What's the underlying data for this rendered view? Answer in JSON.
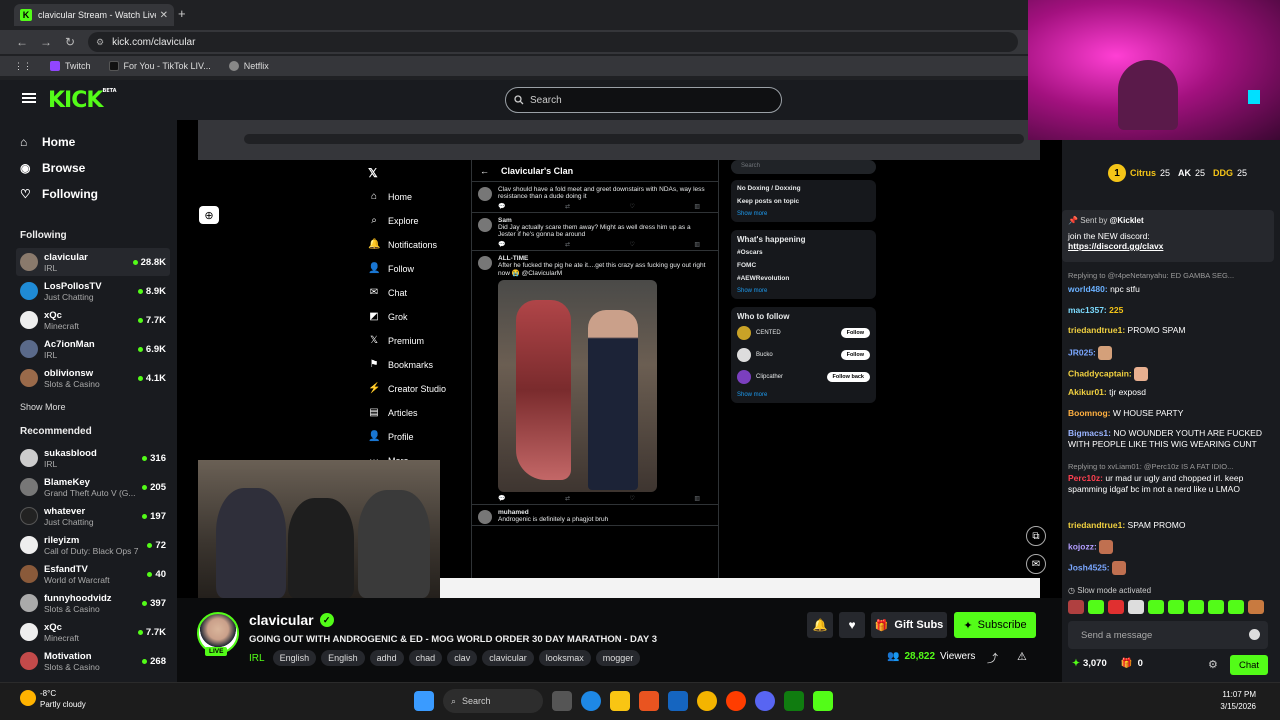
{
  "browser": {
    "tab_title": "clavicular Stream - Watch Live o",
    "url": "kick.com/clavicular",
    "bookmarks": [
      "Twitch",
      "For You - TikTok LIV...",
      "Netflix"
    ]
  },
  "header": {
    "logo": "KICK",
    "beta": "BETA",
    "search_placeholder": "Search"
  },
  "sidebar": {
    "nav": [
      {
        "label": "Home",
        "icon": "home-icon"
      },
      {
        "label": "Browse",
        "icon": "browse-icon"
      },
      {
        "label": "Following",
        "icon": "heart-icon"
      }
    ],
    "following_title": "Following",
    "following": [
      {
        "name": "clavicular",
        "category": "IRL",
        "viewers": "28.8K"
      },
      {
        "name": "LosPollosTV",
        "category": "Just Chatting",
        "viewers": "8.9K"
      },
      {
        "name": "xQc",
        "category": "Minecraft",
        "viewers": "7.7K"
      },
      {
        "name": "Ac7ionMan",
        "category": "IRL",
        "viewers": "6.9K"
      },
      {
        "name": "oblivionsw",
        "category": "Slots & Casino",
        "viewers": "4.1K"
      }
    ],
    "show_more": "Show More",
    "recommended_title": "Recommended",
    "recommended": [
      {
        "name": "sukasblood",
        "category": "IRL",
        "viewers": "316"
      },
      {
        "name": "BlameKey",
        "category": "Grand Theft Auto V (G...",
        "viewers": "205"
      },
      {
        "name": "whatever",
        "category": "Just Chatting",
        "viewers": "197"
      },
      {
        "name": "rileyizm",
        "category": "Call of Duty: Black Ops 7",
        "viewers": "72"
      },
      {
        "name": "EsfandTV",
        "category": "World of Warcraft",
        "viewers": "40"
      },
      {
        "name": "funnyhoodvidz",
        "category": "Slots & Casino",
        "viewers": "397"
      },
      {
        "name": "xQc",
        "category": "Minecraft",
        "viewers": "7.7K"
      },
      {
        "name": "Motivation",
        "category": "Slots & Casino",
        "viewers": "268"
      }
    ]
  },
  "stream_screen": {
    "x_nav": [
      "Home",
      "Explore",
      "Notifications",
      "Follow",
      "Chat",
      "Grok",
      "Premium",
      "Bookmarks",
      "Creator Studio",
      "Articles",
      "Profile",
      "More"
    ],
    "feed_title": "Clavicular's Clan",
    "posts": [
      {
        "text": "Clav should have a fold meet and greet downstairs with NDAs, way less resistance than a dude doing it"
      },
      {
        "author": "Sam",
        "text": "Did Jay actually scare them away? Might as well dress him up as a Jester if he's gonna be around"
      },
      {
        "author": "ALL-TIME",
        "text": "After he fucked the pig he ate it....get this crazy ass fucking guy out right now 😭 @ClavicularM"
      },
      {
        "author": "muhamed",
        "text": "Androgenic is definitely a phagjot bruh"
      }
    ],
    "right_items": [
      "No Doxing / Doxxing",
      "Keep posts on topic"
    ],
    "whats_happening": "What's happening",
    "trends": [
      "#Oscars",
      "FOMC",
      "#AEWRevolution"
    ],
    "show_more": "Show more",
    "who_to_follow": "Who to follow",
    "follow_suggestions": [
      {
        "name": "CENTED",
        "button": "Follow"
      },
      {
        "name": "Bucko",
        "button": "Follow"
      },
      {
        "name": "Clipcather",
        "button": "Follow back"
      }
    ]
  },
  "stream_info": {
    "channel": "clavicular",
    "live": "LIVE",
    "title": "GOING OUT WITH ANDROGENIC & ED - MOG WORLD ORDER 30 DAY MARATHON - DAY 3",
    "category": "IRL",
    "tags": [
      "English",
      "English",
      "adhd",
      "chad",
      "clav",
      "clavicular",
      "looksmax",
      "mogger"
    ],
    "gift_subs": "Gift Subs",
    "subscribe": "Subscribe",
    "viewers": "28,822",
    "viewers_label": "Viewers"
  },
  "chat": {
    "gifters": [
      {
        "name": "Citrus",
        "amount": "25"
      },
      {
        "name": "AK",
        "amount": "25"
      },
      {
        "name": "DDG",
        "amount": "25"
      }
    ],
    "gifter_rank": "1",
    "pinned_by": "Sent by",
    "pinned_user": "@Kicklet",
    "pinned_text": "join the NEW discord:",
    "pinned_link": "https://discord.gg/clavx",
    "messages": [
      {
        "reply": "Replying to @r4peNetanyahu: ED GAMBA SEG..."
      },
      {
        "user": "world480:",
        "text": "npc stfu",
        "color": "#6ab0ff"
      },
      {
        "user": "mac1357:",
        "text": "225",
        "color": "#7ddcff"
      },
      {
        "user": "triedandtrue1:",
        "text": "PROMO SPAM",
        "color": "#f0d040"
      },
      {
        "user": "JR025:",
        "text": "",
        "color": "#7aa7ff"
      },
      {
        "user": "Chaddycaptain:",
        "text": "",
        "color": "#f0d040"
      },
      {
        "user": "Akikur01:",
        "text": "tjr exposd",
        "color": "#f0d040"
      },
      {
        "user": "Boomnog:",
        "text": "W HOUSE PARTY",
        "color": "#ffb040"
      },
      {
        "user": "Bigmacs1:",
        "text": "NO WOUNDER YOUTH ARE FUCKED WITH PEOPLE LIKE THIS WIG WEARING CUNT",
        "color": "#9ab4ff"
      },
      {
        "reply": "Replying to xvLiam01: @Perc10z IS A FAT IDIO..."
      },
      {
        "user": "Perc10z:",
        "text": "ur mad ur ugly and chopped irl. keep spamming idgaf bc im not a nerd like u LMAO",
        "color": "#ff4050"
      },
      {
        "user": "triedandtrue1:",
        "text": "SPAM PROMO",
        "color": "#f0d040"
      },
      {
        "user": "kojozz:",
        "text": "",
        "color": "#b39dff"
      },
      {
        "user": "Josh4525:",
        "text": "",
        "color": "#7aa7ff"
      }
    ],
    "slow_mode": "Slow mode activated",
    "input_placeholder": "Send a message",
    "points": "3,070",
    "gifts": "0",
    "chat_button": "Chat"
  },
  "taskbar": {
    "temp": "-8°C",
    "weather": "Partly cloudy",
    "search": "Search",
    "time": "11:07 PM",
    "date": "3/15/2026"
  },
  "colors": {
    "accent": "#53fc18",
    "bg": "#0b0c0d",
    "panel": "#191b1f"
  }
}
